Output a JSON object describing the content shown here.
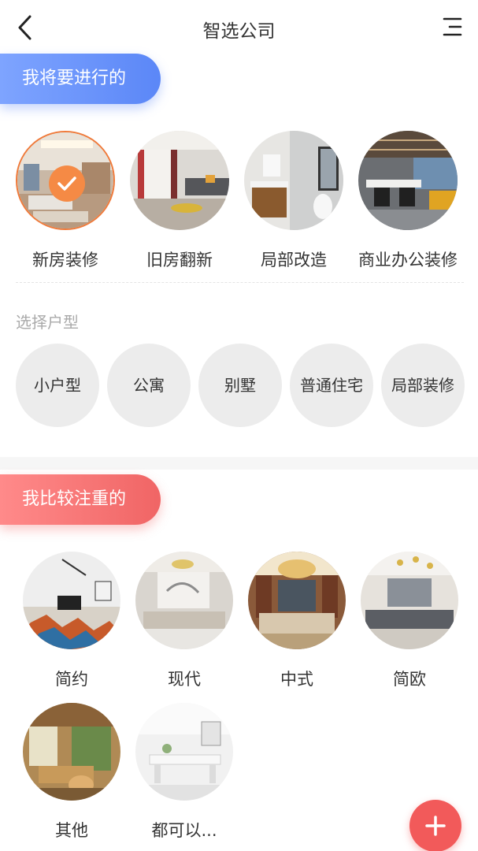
{
  "header": {
    "title": "智选公司",
    "back_icon": "chevron-left-icon",
    "menu_icon": "menu-icon"
  },
  "section1": {
    "title": "我将要进行的",
    "projects": [
      {
        "label": "新房装修",
        "selected": true
      },
      {
        "label": "旧房翻新",
        "selected": false
      },
      {
        "label": "局部改造",
        "selected": false
      },
      {
        "label": "商业办公装修",
        "selected": false
      }
    ],
    "type_label": "选择户型",
    "types": [
      "小户型",
      "公寓",
      "别墅",
      "普通住宅",
      "局部装修"
    ]
  },
  "section2": {
    "title": "我比较注重的",
    "styles": [
      "简约",
      "现代",
      "中式",
      "简欧",
      "其他",
      "都可以..."
    ]
  },
  "fab": {
    "icon": "plus-icon"
  },
  "colors": {
    "blue_pill": "#5b87f7",
    "red_pill": "#f06565",
    "accent_orange": "#f58a45",
    "fab": "#f25a5a"
  }
}
